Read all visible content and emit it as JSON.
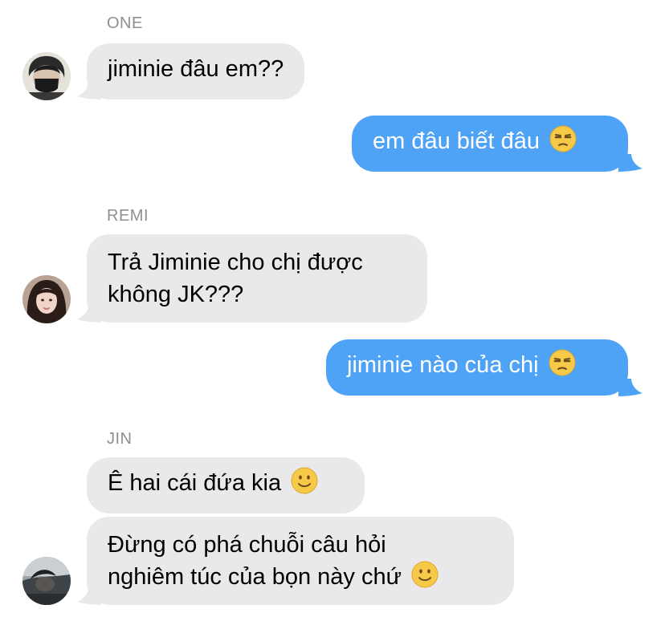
{
  "colors": {
    "incoming_bubble": "#e9e9eb",
    "outgoing_bubble": "#4fa3f7",
    "sender_label": "#8e8e93"
  },
  "groups": [
    {
      "sender": "ONE",
      "avatar_icon": "avatar-one-icon",
      "messages": [
        {
          "text": "jiminie đâu em??"
        }
      ]
    },
    {
      "outgoing": true,
      "messages": [
        {
          "text": "em đâu biết đâu",
          "emoji": "unamused-face-icon"
        }
      ]
    },
    {
      "sender": "REMI",
      "avatar_icon": "avatar-remi-icon",
      "messages": [
        {
          "line1": "Trả Jiminie cho chị được",
          "line2": "không JK???"
        }
      ]
    },
    {
      "outgoing": true,
      "messages": [
        {
          "text": "jiminie nào của chị",
          "emoji": "unamused-face-icon"
        }
      ]
    },
    {
      "sender": "JIN",
      "avatar_icon": "avatar-jin-icon",
      "messages": [
        {
          "text": "Ê hai cái đứa kia",
          "emoji": "slightly-smiling-face-icon"
        },
        {
          "line1": "Đừng có phá chuỗi câu hỏi",
          "line2": "nghiêm túc của bọn này chứ",
          "emoji": "slightly-smiling-face-icon"
        }
      ]
    }
  ]
}
